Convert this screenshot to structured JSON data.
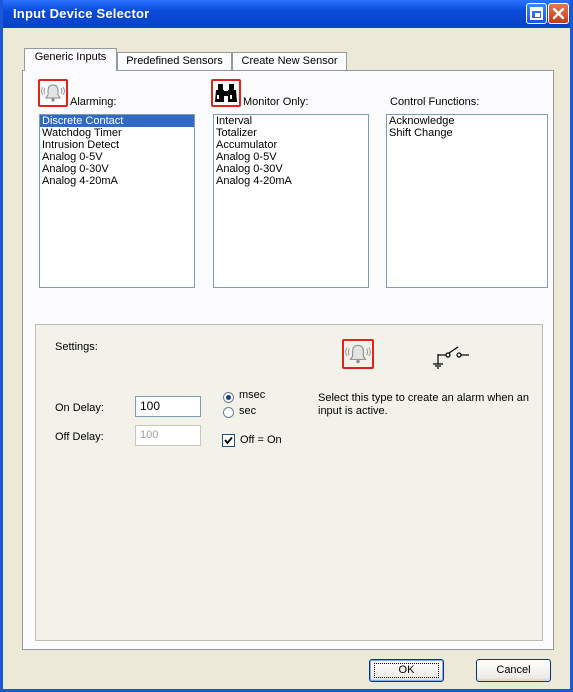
{
  "window": {
    "title": "Input Device Selector"
  },
  "tabs": [
    {
      "label": "Generic Inputs",
      "active": true
    },
    {
      "label": "Predefined Sensors",
      "active": false
    },
    {
      "label": "Create New Sensor",
      "active": false
    }
  ],
  "columns": {
    "alarming": {
      "icon": "alarm-bell-icon",
      "label": "Alarming:",
      "items": [
        "Discrete Contact",
        "Watchdog Timer",
        "Intrusion Detect",
        "Analog 0-5V",
        "Analog 0-30V",
        "Analog 4-20mA"
      ],
      "selected": "Discrete Contact"
    },
    "monitor": {
      "icon": "binoculars-icon",
      "label": "Monitor Only:",
      "items": [
        "Interval",
        "Totalizer",
        "Accumulator",
        "Analog 0-5V",
        "Analog 0-30V",
        "Analog 4-20mA"
      ]
    },
    "control": {
      "label": "Control Functions:",
      "items": [
        "Acknowledge",
        "Shift Change"
      ]
    }
  },
  "settings": {
    "label": "Settings:",
    "on_delay_label": "On Delay:",
    "on_delay_value": "100",
    "off_delay_label": "Off Delay:",
    "off_delay_value": "100",
    "unit_msec": "msec",
    "unit_sec": "sec",
    "unit_selected": "msec",
    "off_eq_on_label": "Off = On",
    "off_eq_on_checked": true,
    "type_icon": "alarm-bell-icon",
    "switch_icon": "switch-symbol-icon",
    "description": "Select this type to create an alarm when an input is active."
  },
  "buttons": {
    "ok": "OK",
    "cancel": "Cancel"
  },
  "colors": {
    "titlebar": "#0a4ad8",
    "selection": "#316ac5",
    "highlight_border": "#e0241c"
  }
}
